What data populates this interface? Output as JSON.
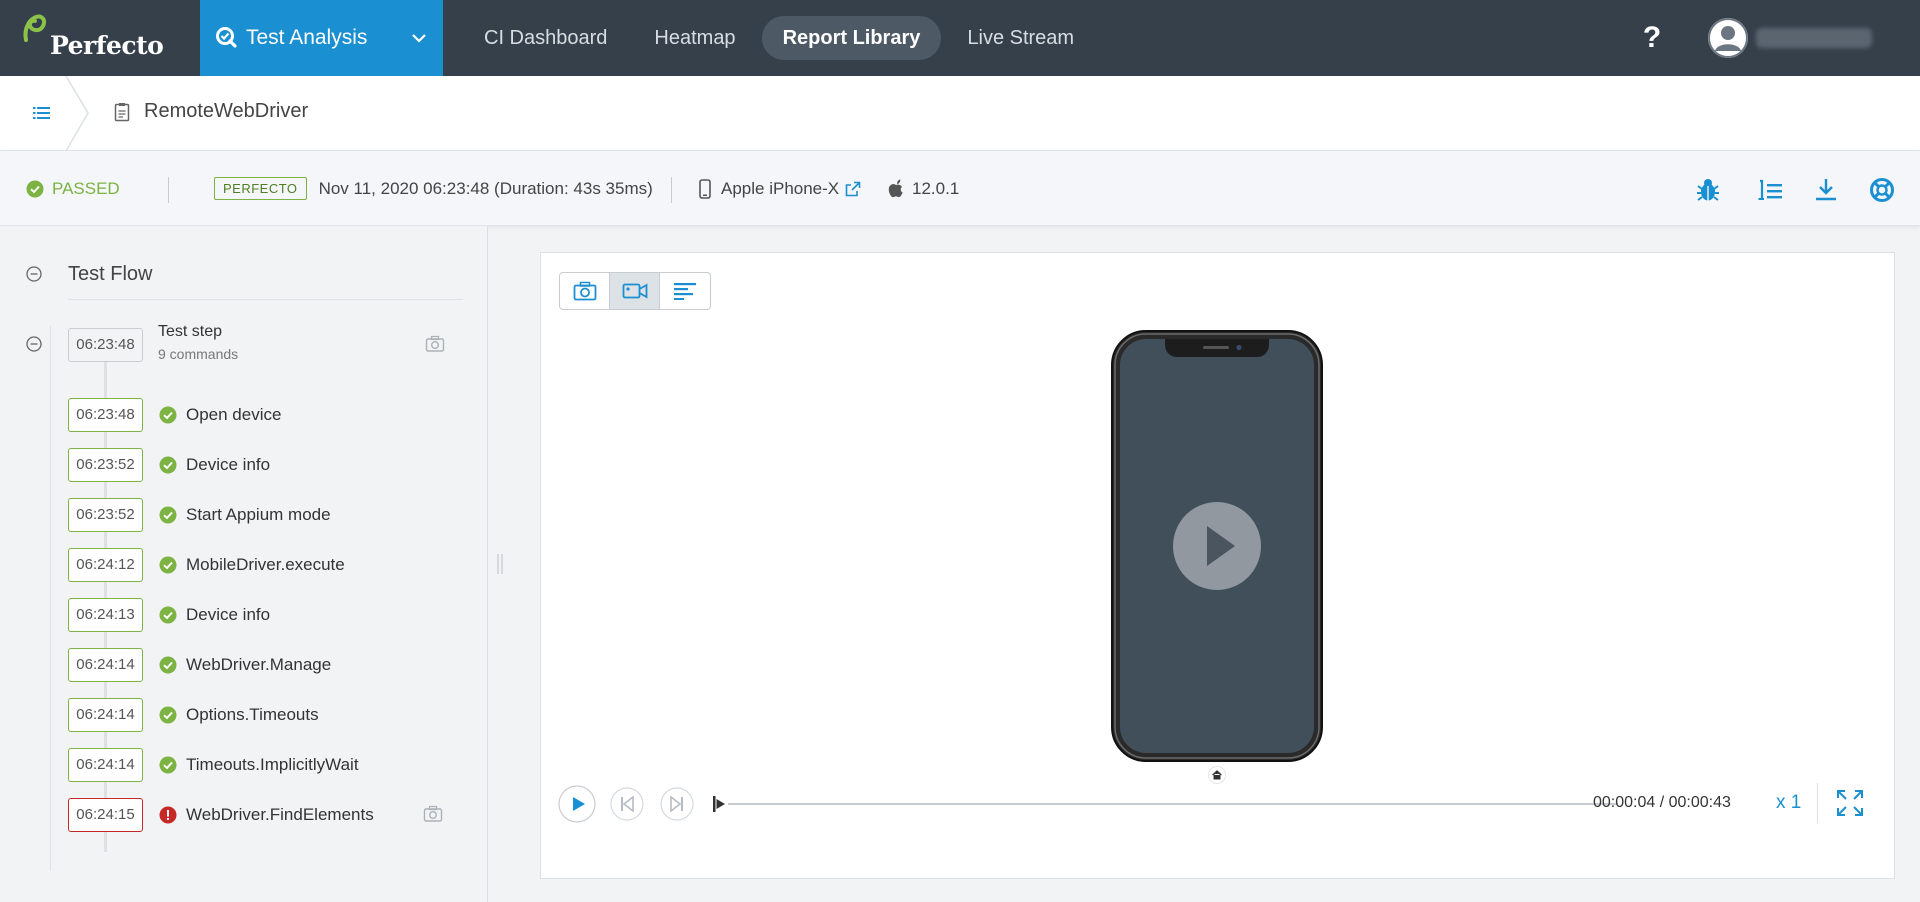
{
  "brand": {
    "name": "Perfecto",
    "accent": "#1a8fd1",
    "nav_bg": "#36404b"
  },
  "app_switcher": {
    "label": "Test Analysis"
  },
  "nav_tabs": [
    {
      "label": "CI Dashboard",
      "active": false
    },
    {
      "label": "Heatmap",
      "active": false
    },
    {
      "label": "Report Library",
      "active": true
    },
    {
      "label": "Live Stream",
      "active": false
    }
  ],
  "help": {
    "label": "?"
  },
  "breadcrumb": {
    "title": "RemoteWebDriver"
  },
  "status": {
    "result": "PASSED",
    "result_color": "#7cb342",
    "tag": "PERFECTO",
    "datetime": "Nov 11, 2020 06:23:48 (Duration: 43s 35ms)",
    "device": "Apple iPhone-X",
    "os_version": "12.0.1"
  },
  "test_flow": {
    "title": "Test Flow",
    "step": {
      "time": "06:23:48",
      "name": "Test step",
      "subtitle": "9 commands"
    },
    "commands": [
      {
        "time": "06:23:48",
        "label": "Open device",
        "status": "passed"
      },
      {
        "time": "06:23:52",
        "label": "Device info",
        "status": "passed"
      },
      {
        "time": "06:23:52",
        "label": "Start Appium mode",
        "status": "passed"
      },
      {
        "time": "06:24:12",
        "label": "MobileDriver.execute",
        "status": "passed"
      },
      {
        "time": "06:24:13",
        "label": "Device info",
        "status": "passed"
      },
      {
        "time": "06:24:14",
        "label": "WebDriver.Manage",
        "status": "passed"
      },
      {
        "time": "06:24:14",
        "label": "Options.Timeouts",
        "status": "passed"
      },
      {
        "time": "06:24:14",
        "label": "Timeouts.ImplicitlyWait",
        "status": "passed"
      },
      {
        "time": "06:24:15",
        "label": "WebDriver.FindElements",
        "status": "failed"
      }
    ]
  },
  "player": {
    "current_time": "00:00:04",
    "total_time": "00:00:43",
    "timecode": "00:00:04 / 00:00:43",
    "speed": "x 1",
    "progress_fraction": 0.09
  }
}
